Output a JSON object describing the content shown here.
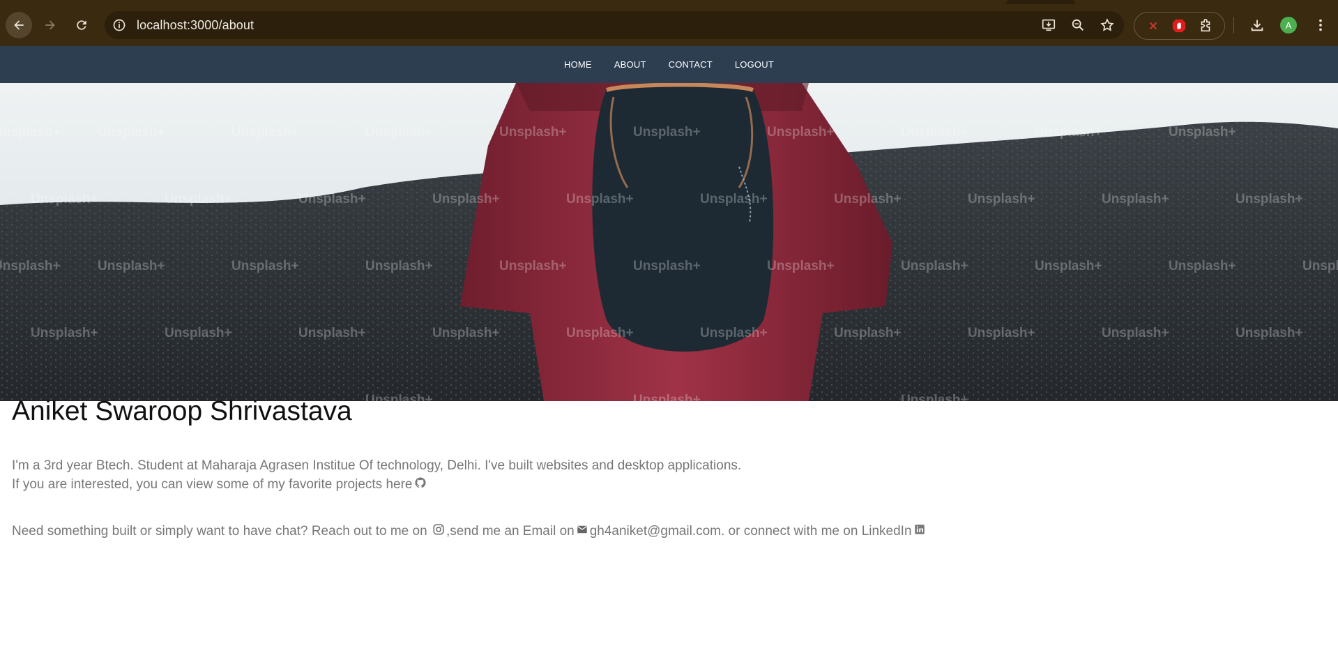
{
  "browser": {
    "url": "localhost:3000/about",
    "profile_initial": "A"
  },
  "nav": {
    "items": [
      "HOME",
      "ABOUT",
      "CONTACT",
      "LOGOUT"
    ]
  },
  "hero": {
    "watermark": "Unsplash+"
  },
  "about": {
    "name": "Aniket Swaroop Shrivastava",
    "line1": "I'm a 3rd year Btech. Student at Maharaja Agrasen Institue Of technology, Delhi. I've built websites and desktop applications.",
    "line2": "If you are interested, you can view some of my favorite projects here",
    "contact_part1": "Need something built or simply want to have chat? Reach out to me on ",
    "contact_part2": ",send me an Email on",
    "email": "gh4aniket@gmail.com.",
    "contact_part3": " or connect with me on LinkedIn"
  },
  "icons": {
    "github": "github-icon",
    "instagram": "instagram-icon",
    "email": "mail-icon",
    "linkedin": "linkedin-icon"
  },
  "colors": {
    "navbar": "#2c3e50",
    "chrome": "#3a2a10",
    "jacket": "#8c2a3c",
    "backpack": "#1d2a33"
  }
}
